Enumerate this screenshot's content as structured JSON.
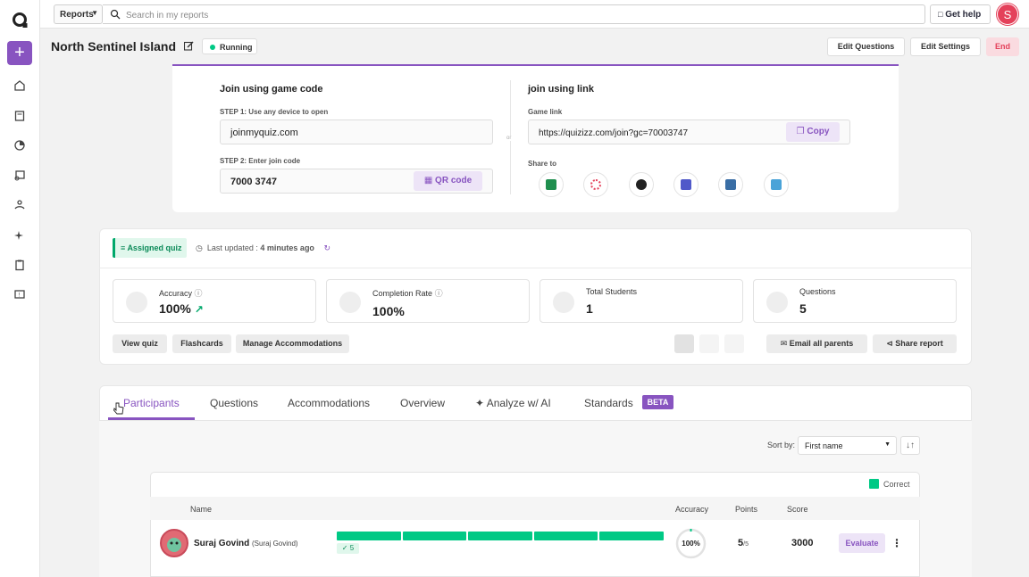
{
  "topbar": {
    "reports_select": "Reports",
    "search_placeholder": "Search in my reports",
    "help_label": "Get help",
    "avatar_letter": "S"
  },
  "header": {
    "title": "North Sentinel Island",
    "status": "Running",
    "edit_questions": "Edit Questions",
    "edit_settings": "Edit Settings",
    "end": "End"
  },
  "join": {
    "code_title": "Join using game code",
    "step1": "STEP 1: Use any device to open",
    "url": "joinmyquiz.com",
    "step2": "STEP 2: Enter join code",
    "code": "7000 3747",
    "qr_label": "QR code",
    "or": "or",
    "link_title": "join using link",
    "game_link_label": "Game link",
    "game_link": "https://quizizz.com/join?gc=70003747",
    "copy_label": "Copy",
    "share_label": "Share to"
  },
  "stats": {
    "assigned_label": "Assigned quiz",
    "last_updated_prefix": "Last updated : ",
    "last_updated_value": "4 minutes ago",
    "cards": [
      {
        "label": "Accuracy",
        "value": "100%"
      },
      {
        "label": "Completion Rate",
        "value": "100%"
      },
      {
        "label": "Total Students",
        "value": "1"
      },
      {
        "label": "Questions",
        "value": "5"
      }
    ],
    "view_quiz": "View quiz",
    "flashcards": "Flashcards",
    "manage_accommodations": "Manage Accommodations",
    "email_parents": "Email all parents",
    "share_report": "Share report"
  },
  "tabs": [
    {
      "label": "Participants"
    },
    {
      "label": "Questions"
    },
    {
      "label": "Accommodations"
    },
    {
      "label": "Overview"
    },
    {
      "label": "Analyze w/ AI"
    },
    {
      "label": "Standards"
    }
  ],
  "beta_label": "BETA",
  "list": {
    "sort_label": "Sort by:",
    "sort_value": "First name",
    "legend_correct": "Correct",
    "headers": {
      "name": "Name",
      "accuracy": "Accuracy",
      "points": "Points",
      "score": "Score"
    },
    "rows": [
      {
        "name": "Suraj Govind",
        "sub": "(Suraj Govind)",
        "correct_count": "5",
        "questions_correct": [
          1,
          1,
          1,
          1,
          1
        ],
        "accuracy": "100%",
        "points": "5",
        "points_total": "/5",
        "score": "3000",
        "evaluate": "Evaluate"
      }
    ]
  },
  "colors": {
    "accent": "#8854c0",
    "correct": "#00c985",
    "danger": "#e4415a"
  }
}
